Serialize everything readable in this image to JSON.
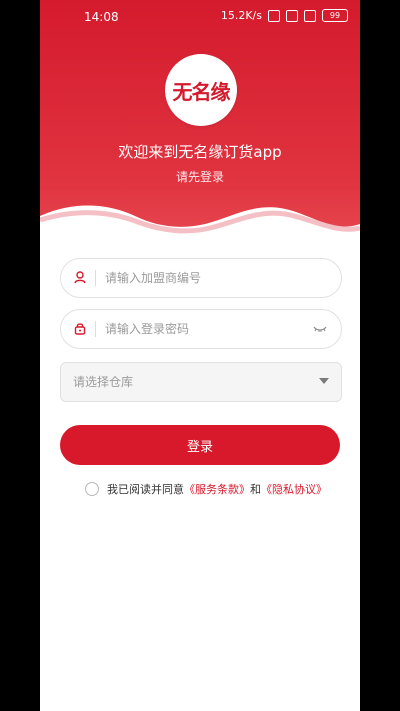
{
  "status_bar": {
    "time": "14:08",
    "network_speed": "15.2K/s",
    "battery_level": "99"
  },
  "header": {
    "logo_text": "无名缘",
    "welcome_text": "欢迎来到无名缘订货app",
    "subtitle": "请先登录",
    "brand_color": "#d8192b"
  },
  "form": {
    "franchise_placeholder": "请输入加盟商编号",
    "password_placeholder": "请输入登录密码",
    "warehouse_placeholder": "请选择仓库",
    "login_label": "登录"
  },
  "agreement": {
    "prefix": "我已阅读并同意",
    "service_terms": "《服务条款》",
    "and": "和",
    "privacy_policy": "《隐私协议》"
  },
  "icons": [
    "user-icon",
    "lock-icon",
    "eye-closed-icon",
    "dropdown-caret-icon"
  ]
}
